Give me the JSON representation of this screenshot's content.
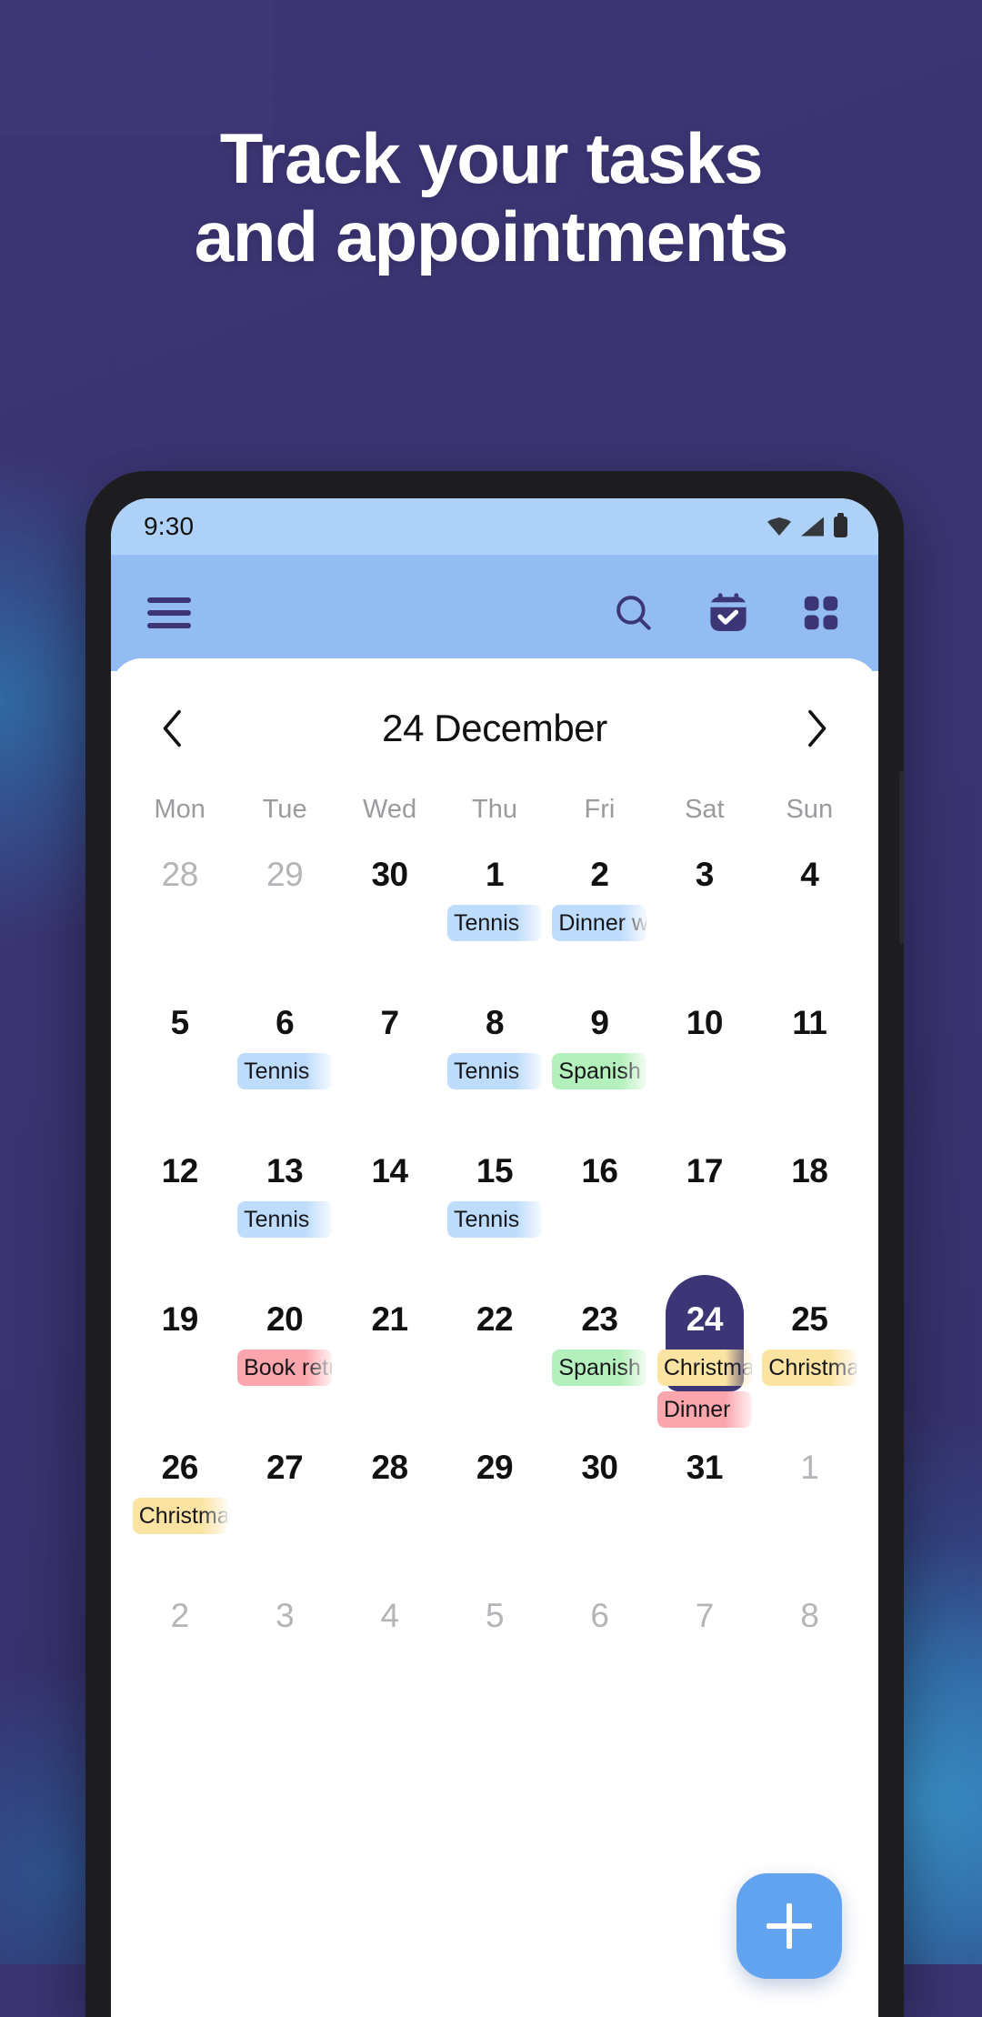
{
  "background": {
    "base_color": "#3a3472",
    "glow_color": "#3a96cd"
  },
  "headline": {
    "line1": "Track your tasks",
    "line2": "and appointments",
    "color": "#ffffff"
  },
  "phone": {
    "status_bar": {
      "time": "9:30",
      "icons": [
        "wifi-icon",
        "signal-icon",
        "battery-icon"
      ],
      "background": "#aed2f7"
    },
    "app_bar": {
      "background": "#93bdf2",
      "menu_label": "Menu",
      "actions": [
        "search-icon",
        "calendar-check-icon",
        "grid-icon"
      ]
    },
    "calendar": {
      "prev_label": "‹",
      "next_label": "›",
      "month_title": "24 December",
      "weekdays": [
        "Mon",
        "Tue",
        "Wed",
        "Thu",
        "Fri",
        "Sat",
        "Sun"
      ],
      "selected_day": 24,
      "weeks": [
        [
          {
            "day": "28",
            "muted": true,
            "events": []
          },
          {
            "day": "29",
            "muted": true,
            "events": []
          },
          {
            "day": "30",
            "muted": false,
            "events": []
          },
          {
            "day": "1",
            "muted": false,
            "events": [
              {
                "label": "Tennis",
                "color": "blue"
              }
            ]
          },
          {
            "day": "2",
            "muted": false,
            "events": [
              {
                "label": "Dinner with",
                "color": "blue"
              }
            ]
          },
          {
            "day": "3",
            "muted": false,
            "events": []
          },
          {
            "day": "4",
            "muted": false,
            "events": []
          }
        ],
        [
          {
            "day": "5",
            "muted": false,
            "events": []
          },
          {
            "day": "6",
            "muted": false,
            "events": [
              {
                "label": "Tennis",
                "color": "blue"
              }
            ]
          },
          {
            "day": "7",
            "muted": false,
            "events": []
          },
          {
            "day": "8",
            "muted": false,
            "events": [
              {
                "label": "Tennis",
                "color": "blue"
              }
            ]
          },
          {
            "day": "9",
            "muted": false,
            "events": [
              {
                "label": "Spanish",
                "color": "green"
              }
            ]
          },
          {
            "day": "10",
            "muted": false,
            "events": []
          },
          {
            "day": "11",
            "muted": false,
            "events": []
          }
        ],
        [
          {
            "day": "12",
            "muted": false,
            "events": []
          },
          {
            "day": "13",
            "muted": false,
            "events": [
              {
                "label": "Tennis",
                "color": "blue"
              }
            ]
          },
          {
            "day": "14",
            "muted": false,
            "events": []
          },
          {
            "day": "15",
            "muted": false,
            "events": [
              {
                "label": "Tennis",
                "color": "blue"
              }
            ]
          },
          {
            "day": "16",
            "muted": false,
            "events": []
          },
          {
            "day": "17",
            "muted": false,
            "events": []
          },
          {
            "day": "18",
            "muted": false,
            "events": []
          }
        ],
        [
          {
            "day": "19",
            "muted": false,
            "events": []
          },
          {
            "day": "20",
            "muted": false,
            "events": [
              {
                "label": "Book return",
                "color": "pink"
              }
            ]
          },
          {
            "day": "21",
            "muted": false,
            "events": []
          },
          {
            "day": "22",
            "muted": false,
            "events": []
          },
          {
            "day": "23",
            "muted": false,
            "events": [
              {
                "label": "Spanish",
                "color": "green"
              }
            ]
          },
          {
            "day": "24",
            "muted": false,
            "selected": true,
            "events": [
              {
                "label": "Christmas",
                "color": "yellow"
              },
              {
                "label": "Dinner",
                "color": "pink"
              }
            ]
          },
          {
            "day": "25",
            "muted": false,
            "events": [
              {
                "label": "Christmas",
                "color": "yellow"
              }
            ]
          }
        ],
        [
          {
            "day": "26",
            "muted": false,
            "events": [
              {
                "label": "Christmas",
                "color": "yellow"
              }
            ]
          },
          {
            "day": "27",
            "muted": false,
            "events": []
          },
          {
            "day": "28",
            "muted": false,
            "events": []
          },
          {
            "day": "29",
            "muted": false,
            "events": []
          },
          {
            "day": "30",
            "muted": false,
            "events": []
          },
          {
            "day": "31",
            "muted": false,
            "events": []
          },
          {
            "day": "1",
            "muted": true,
            "events": []
          }
        ],
        [
          {
            "day": "2",
            "muted": true,
            "events": []
          },
          {
            "day": "3",
            "muted": true,
            "events": []
          },
          {
            "day": "4",
            "muted": true,
            "events": []
          },
          {
            "day": "5",
            "muted": true,
            "events": []
          },
          {
            "day": "6",
            "muted": true,
            "events": []
          },
          {
            "day": "7",
            "muted": true,
            "events": []
          },
          {
            "day": "8",
            "muted": true,
            "events": []
          }
        ]
      ]
    },
    "fab": {
      "icon": "plus-icon",
      "label": "Add event",
      "color": "#62a3ef"
    }
  }
}
